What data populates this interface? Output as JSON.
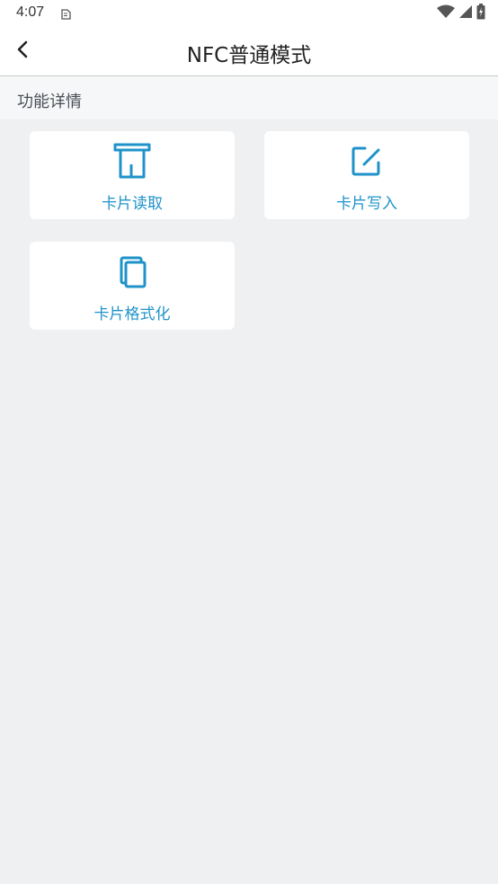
{
  "status_bar": {
    "time": "4:07"
  },
  "app_bar": {
    "title": "NFC普通模式"
  },
  "section": {
    "title": "功能详情"
  },
  "functions": [
    {
      "label": "卡片读取",
      "icon": "card-reader-icon"
    },
    {
      "label": "卡片写入",
      "icon": "edit-icon"
    },
    {
      "label": "卡片格式化",
      "icon": "copy-cards-icon"
    }
  ],
  "colors": {
    "accent": "#1f93c9",
    "background": "#eff0f2",
    "card": "#ffffff"
  }
}
